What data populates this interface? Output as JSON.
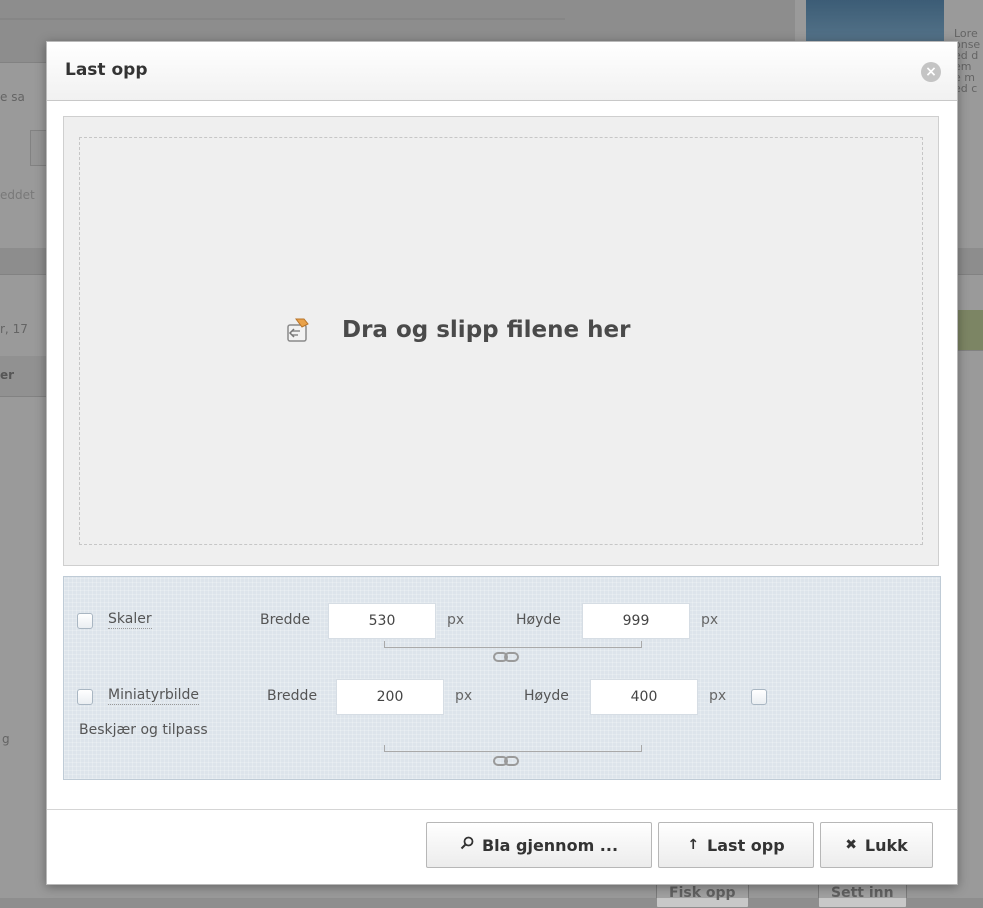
{
  "background": {
    "fragments": [
      "e sa",
      "eddet",
      "r, 17",
      "er",
      "g"
    ],
    "side_text": [
      "Lore",
      "onse",
      "ed d",
      "em",
      "e m",
      "ed c"
    ],
    "buttons": [
      "Fisk opp",
      "Sett inn"
    ]
  },
  "dialog": {
    "title": "Last opp",
    "dropzone": {
      "message": "Dra og slipp filene her"
    },
    "scale": {
      "label": "Skaler",
      "width_label": "Bredde",
      "width_value": "530",
      "height_label": "Høyde",
      "height_value": "999",
      "unit": "px"
    },
    "thumbnail": {
      "label": "Miniatyrbilde",
      "width_label": "Bredde",
      "width_value": "200",
      "height_label": "Høyde",
      "height_value": "400",
      "unit": "px",
      "crop_label": "Beskjær og tilpass"
    },
    "footer": {
      "browse_label": "Bla gjennom ...",
      "upload_label": "Last opp",
      "close_label": "Lukk"
    }
  }
}
